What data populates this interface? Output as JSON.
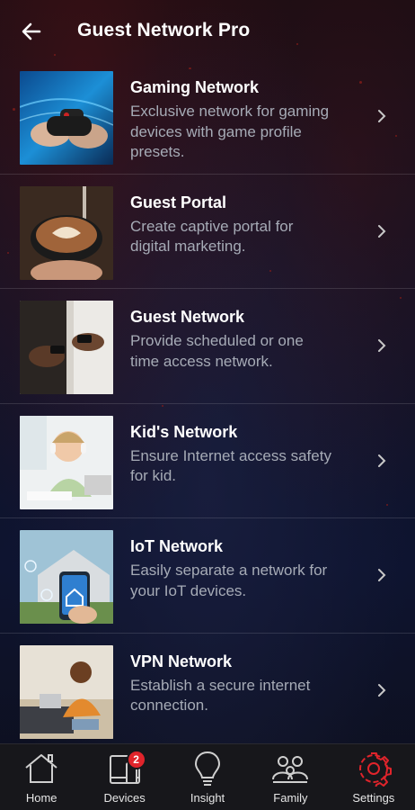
{
  "header": {
    "title": "Guest Network Pro",
    "back_icon": "arrow-left-icon"
  },
  "items": [
    {
      "title": "Gaming Network",
      "desc_line1": "Exclusive network for gaming",
      "desc_line2": "devices with game profile",
      "desc_line3": "presets.",
      "image": "gaming-controller-photo"
    },
    {
      "title": "Guest Portal",
      "desc_line1": "Create captive portal for",
      "desc_line2": "digital marketing.",
      "desc_line3": "",
      "image": "latte-art-photo"
    },
    {
      "title": "Guest Network",
      "desc_line1": "Provide scheduled or one",
      "desc_line2": "time access network.",
      "desc_line3": "",
      "image": "people-with-phones-photo"
    },
    {
      "title": "Kid's Network",
      "desc_line1": "Ensure Internet access safety",
      "desc_line2": "for kid.",
      "desc_line3": "",
      "image": "child-with-headphones-photo"
    },
    {
      "title": "IoT Network",
      "desc_line1": "Easily separate a network for",
      "desc_line2": "your IoT devices.",
      "desc_line3": "",
      "image": "smart-home-phone-photo"
    },
    {
      "title": "VPN Network",
      "desc_line1": "Establish a secure internet",
      "desc_line2": "connection.",
      "desc_line3": "",
      "image": "woman-with-laptop-photo"
    }
  ],
  "nav": [
    {
      "label": "Home",
      "icon": "home-icon"
    },
    {
      "label": "Devices",
      "icon": "devices-icon",
      "badge": "2"
    },
    {
      "label": "Insight",
      "icon": "lightbulb-icon"
    },
    {
      "label": "Family",
      "icon": "family-icon"
    },
    {
      "label": "Settings",
      "icon": "gear-icon",
      "active": true
    }
  ],
  "colors": {
    "accent": "#e0242b",
    "badge": "#e0242b",
    "description": "#a6abb6",
    "nav_bg": "#17171b"
  }
}
